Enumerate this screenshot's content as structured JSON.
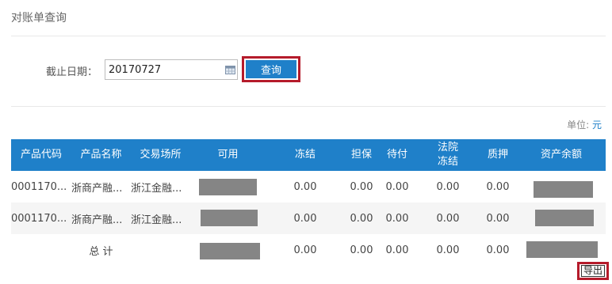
{
  "page": {
    "title": "对账单查询"
  },
  "filter": {
    "date_label": "截止日期：",
    "date_value": "20170727",
    "query_label": "查询"
  },
  "unit": {
    "prefix": "单位:",
    "value": "元"
  },
  "table": {
    "headers": [
      "产品代码",
      "产品名称",
      "交易场所",
      "可用",
      "冻结",
      "担保",
      "待付",
      "法院\n冻结",
      "质押",
      "资产余额"
    ],
    "rows": [
      {
        "code": "0001170...",
        "name": "浙商产融...",
        "venue": "浙江金融...",
        "frozen": "0.00",
        "guarantee": "0.00",
        "pending": "0.00",
        "court_frozen": "0.00",
        "pledge": "0.00"
      },
      {
        "code": "0001170...",
        "name": "浙商产融...",
        "venue": "浙江金融...",
        "frozen": "0.00",
        "guarantee": "0.00",
        "pending": "0.00",
        "court_frozen": "0.00",
        "pledge": "0.00"
      }
    ],
    "total": {
      "label": "总 计",
      "frozen": "0.00",
      "guarantee": "0.00",
      "pending": "0.00",
      "court_frozen": "0.00",
      "pledge": "0.00"
    }
  },
  "export": {
    "label": "导出"
  },
  "colors": {
    "accent": "#1f80c9",
    "highlight": "#b51b2b",
    "mask": "#858585"
  }
}
